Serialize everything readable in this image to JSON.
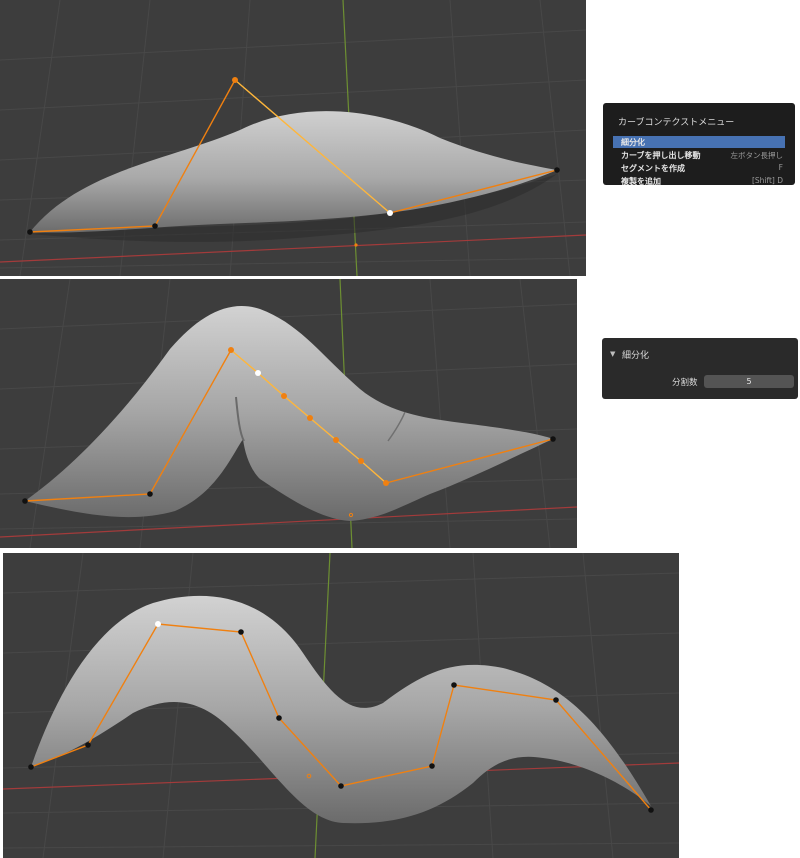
{
  "context_menu": {
    "title": "カーブコンテクストメニュー",
    "items": [
      {
        "label": "細分化",
        "shortcut": "",
        "active": true
      },
      {
        "label": "カーブを押し出し移動",
        "shortcut": "左ボタン長押し",
        "active": false
      },
      {
        "label": "セグメントを作成",
        "shortcut": "F",
        "active": false
      },
      {
        "label": "複製を追加",
        "shortcut": "[Shift] D",
        "active": false
      }
    ]
  },
  "operator_panel": {
    "title": "細分化",
    "field_label": "分割数",
    "field_value": "5"
  },
  "colors": {
    "viewport_bg": "#3d3d3d",
    "grid_line": "#474747",
    "x_axis": "#a33b3b",
    "y_axis": "#6d8f32",
    "mesh_fill": "#a8a8a8",
    "curve_orange": "#f08010",
    "curve_selected": "#ffb63a",
    "menu_highlight": "#4772b3"
  },
  "icons": {
    "panel_collapse": "triangle-down-icon"
  }
}
